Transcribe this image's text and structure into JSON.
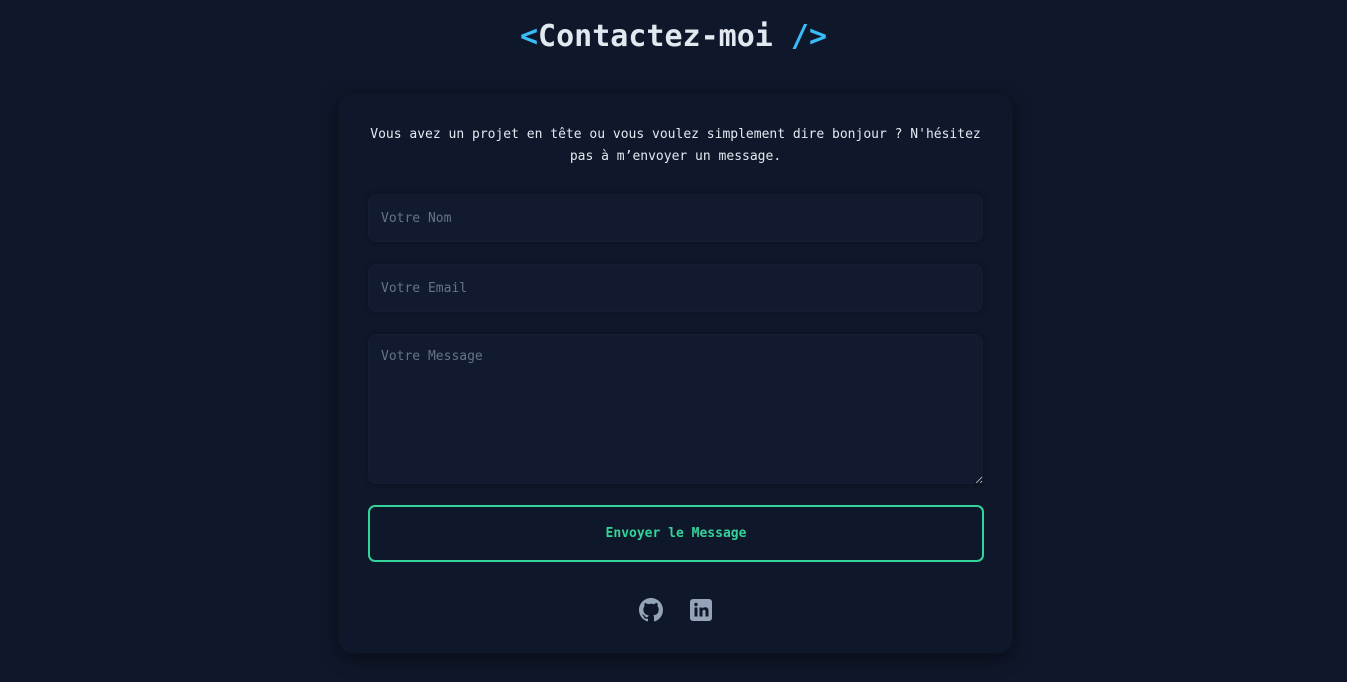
{
  "header": {
    "open_bracket": "<",
    "title": "Contactez-moi",
    "close_bracket": "/>"
  },
  "contact": {
    "intro": "Vous avez un projet en tête ou vous voulez simplement dire bonjour ? N'hésitez pas à m’envoyer un message.",
    "name_placeholder": "Votre Nom",
    "email_placeholder": "Votre Email",
    "message_placeholder": "Votre Message",
    "submit_label": "Envoyer le Message"
  },
  "socials": [
    {
      "icon": "github-icon"
    },
    {
      "icon": "linkedin-icon"
    }
  ],
  "colors": {
    "background": "#0f172a",
    "accent_bracket": "#38bdf8",
    "accent_button": "#34d399",
    "icon": "#94a3b8"
  }
}
